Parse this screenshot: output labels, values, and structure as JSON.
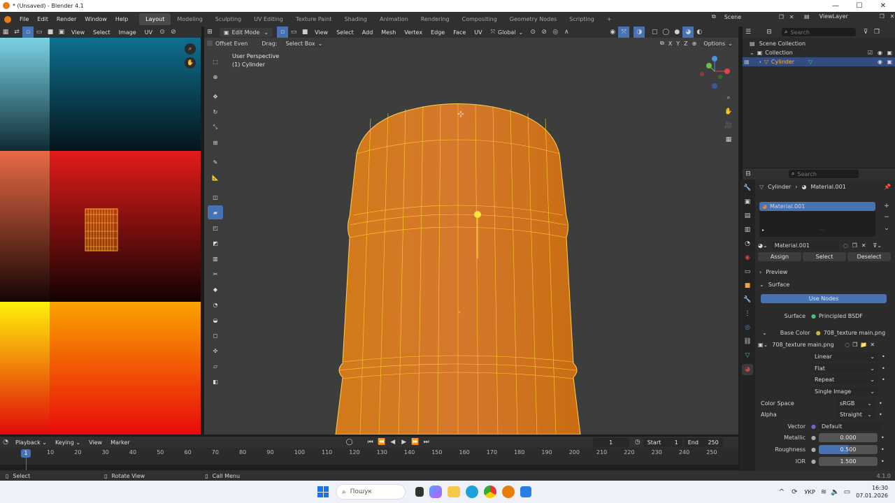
{
  "window": {
    "title": "* (Unsaved) - Blender 4.1",
    "min": "—",
    "max": "☐",
    "close": "✕"
  },
  "menus": [
    "File",
    "Edit",
    "Render",
    "Window",
    "Help"
  ],
  "workspaces": [
    "Layout",
    "Modeling",
    "Sculpting",
    "UV Editing",
    "Texture Paint",
    "Shading",
    "Animation",
    "Rendering",
    "Compositing",
    "Geometry Nodes",
    "Scripting"
  ],
  "active_workspace": "Layout",
  "scene": {
    "label": "Scene",
    "viewlayer": "ViewLayer"
  },
  "uv_editor": {
    "menus": [
      "View",
      "Select",
      "Image",
      "UV"
    ]
  },
  "viewport": {
    "mode": "Edit Mode",
    "menus": [
      "View",
      "Select",
      "Add",
      "Mesh",
      "Vertex",
      "Edge",
      "Face",
      "UV"
    ],
    "orientation": "Global",
    "offset_even": "Offset Even",
    "drag_label": "Drag:",
    "drag_value": "Select Box",
    "options": "Options",
    "axes": [
      "X",
      "Y",
      "Z"
    ],
    "overlay_title": "User Perspective",
    "overlay_object": "(1) Cylinder"
  },
  "outliner": {
    "search_placeholder": "Search",
    "scene_collection": "Scene Collection",
    "collection": "Collection",
    "cylinder": "Cylinder"
  },
  "properties": {
    "search_placeholder": "Search",
    "breadcrumb_object": "Cylinder",
    "breadcrumb_material": "Material.001",
    "slot_name": "Material.001",
    "material_name": "Material.001",
    "assign": "Assign",
    "select": "Select",
    "deselect": "Deselect",
    "preview": "Preview",
    "surface_section": "Surface",
    "use_nodes": "Use Nodes",
    "surface_label": "Surface",
    "surface_value": "Principled BSDF",
    "base_color_label": "Base Color",
    "base_color_value": "708_texture main.png",
    "image_name": "708_texture main.png",
    "interp": "Linear",
    "projection": "Flat",
    "extension": "Repeat",
    "source": "Single Image",
    "color_space_label": "Color Space",
    "color_space_value": "sRGB",
    "alpha_label": "Alpha",
    "alpha_value": "Straight",
    "vector_label": "Vector",
    "vector_value": "Default",
    "metallic_label": "Metallic",
    "metallic_value": "0.000",
    "roughness_label": "Roughness",
    "roughness_value": "0.500",
    "ior_label": "IOR",
    "ior_value": "1.500"
  },
  "timeline": {
    "menus": [
      "Playback",
      "Keying",
      "View",
      "Marker"
    ],
    "current_frame": "1",
    "start_label": "Start",
    "start_value": "1",
    "end_label": "End",
    "end_value": "250",
    "ruler": [
      "10",
      "20",
      "30",
      "40",
      "50",
      "60",
      "70",
      "80",
      "90",
      "100",
      "110",
      "120",
      "130",
      "140",
      "150",
      "160",
      "170",
      "180",
      "190",
      "200",
      "210",
      "220",
      "230",
      "240",
      "250"
    ],
    "playhead": "1"
  },
  "statusbar": {
    "select": "Select",
    "rotate": "Rotate View",
    "call_menu": "Call Menu",
    "version": "4.1.0"
  },
  "taskbar": {
    "search_placeholder": "Пошук",
    "lang": "УКР",
    "time": "16:30",
    "date": "07.01.2026"
  },
  "colors": {
    "accent": "#4772b3",
    "mesh_orange": "#d98a1e",
    "wire_yellow": "#ffd24a"
  }
}
